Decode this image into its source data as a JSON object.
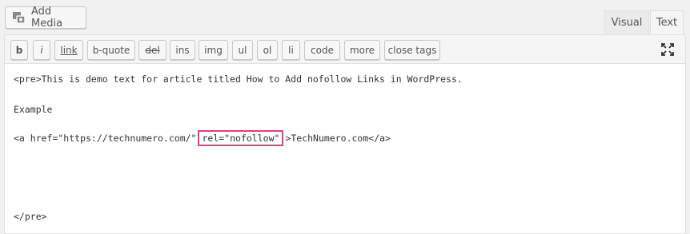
{
  "header": {
    "add_media_label": "Add Media",
    "tabs": [
      {
        "label": "Visual",
        "active": false
      },
      {
        "label": "Text",
        "active": true
      }
    ]
  },
  "toolbar": {
    "buttons": [
      {
        "label": "b"
      },
      {
        "label": "i"
      },
      {
        "label": "link"
      },
      {
        "label": "b-quote"
      },
      {
        "label": "del"
      },
      {
        "label": "ins"
      },
      {
        "label": "img"
      },
      {
        "label": "ul"
      },
      {
        "label": "ol"
      },
      {
        "label": "li"
      },
      {
        "label": "code"
      },
      {
        "label": "more"
      },
      {
        "label": "close tags"
      }
    ],
    "fullscreen_icon": "fullscreen-icon"
  },
  "editor": {
    "line1": "<pre>This is demo text for article titled How to Add nofollow Links in WordPress.",
    "line2": "Example",
    "line3_before": "<a href=\"https://technumero.com/\"",
    "line3_highlight": "rel=\"nofollow\"",
    "line3_after": ">TechNumero.com</a>",
    "line4": "</pre>"
  },
  "colors": {
    "highlight_border": "#e0417f"
  }
}
